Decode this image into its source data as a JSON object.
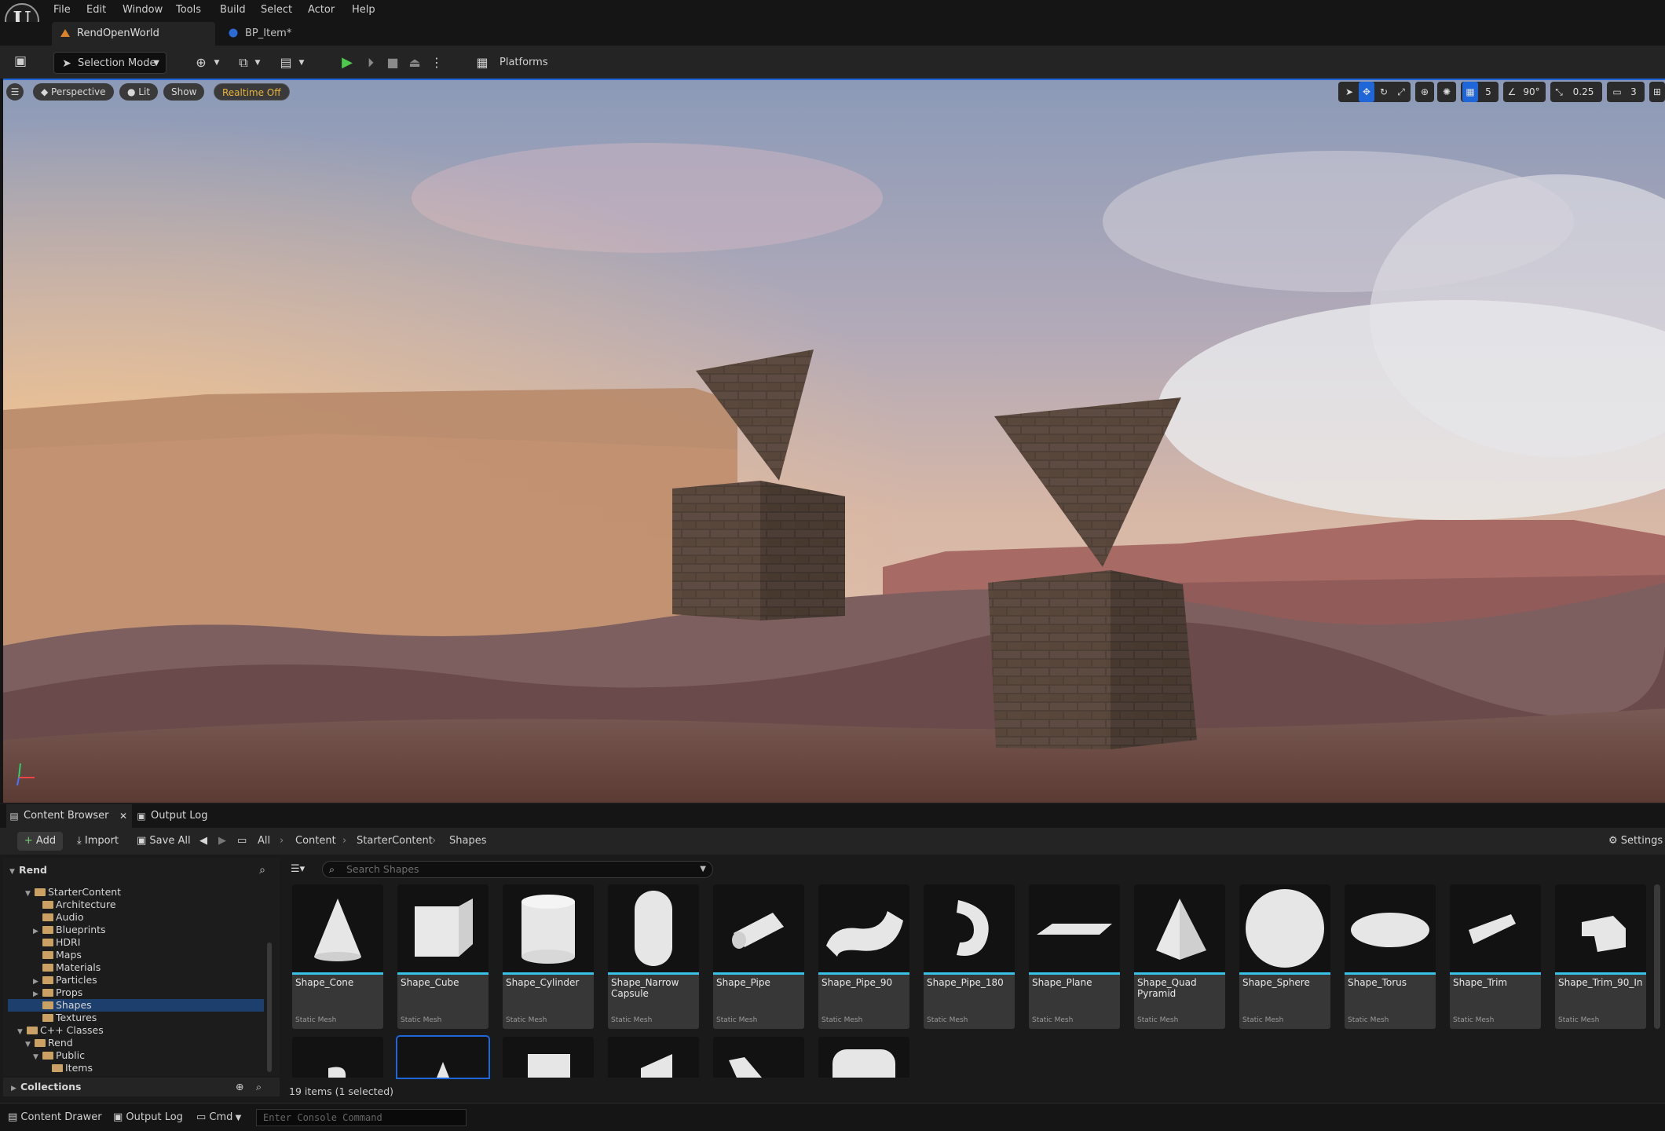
{
  "menu": [
    "File",
    "Edit",
    "Window",
    "Tools",
    "Build",
    "Select",
    "Actor",
    "Help"
  ],
  "tabs": {
    "level": "RendOpenWorld",
    "blueprint": "BP_Item*"
  },
  "toolbar": {
    "mode": "Selection Mode",
    "platforms": "Platforms"
  },
  "viewport": {
    "perspective": "Perspective",
    "lit": "Lit",
    "show": "Show",
    "realtime": "Realtime Off",
    "grid_snap": "5",
    "rotation_snap": "90°",
    "scale_snap": "0.25",
    "camera_speed": "3"
  },
  "panels": {
    "content_browser": "Content Browser",
    "output_log": "Output Log"
  },
  "cb_toolbar": {
    "add": "Add",
    "import": "Import",
    "save_all": "Save All",
    "settings": "Settings"
  },
  "breadcrumb": [
    "All",
    "Content",
    "StarterContent",
    "Shapes"
  ],
  "tree": {
    "root": "Rend",
    "items": [
      "StarterContent",
      "Architecture",
      "Audio",
      "Blueprints",
      "HDRI",
      "Maps",
      "Materials",
      "Particles",
      "Props",
      "Shapes",
      "Textures",
      "C++ Classes",
      "Rend",
      "Public",
      "Items"
    ],
    "collections": "Collections"
  },
  "search": {
    "placeholder": "Search Shapes"
  },
  "assets": [
    {
      "name": "Shape_Cone",
      "type": "Static Mesh"
    },
    {
      "name": "Shape_Cube",
      "type": "Static Mesh"
    },
    {
      "name": "Shape_Cylinder",
      "type": "Static Mesh"
    },
    {
      "name": "Shape_Narrow Capsule",
      "type": "Static Mesh"
    },
    {
      "name": "Shape_Pipe",
      "type": "Static Mesh"
    },
    {
      "name": "Shape_Pipe_90",
      "type": "Static Mesh"
    },
    {
      "name": "Shape_Pipe_180",
      "type": "Static Mesh"
    },
    {
      "name": "Shape_Plane",
      "type": "Static Mesh"
    },
    {
      "name": "Shape_Quad Pyramid",
      "type": "Static Mesh"
    },
    {
      "name": "Shape_Sphere",
      "type": "Static Mesh"
    },
    {
      "name": "Shape_Torus",
      "type": "Static Mesh"
    },
    {
      "name": "Shape_Trim",
      "type": "Static Mesh"
    },
    {
      "name": "Shape_Trim_90_In",
      "type": "Static Mesh"
    }
  ],
  "status": "19 items (1 selected)",
  "statusbar": {
    "drawer": "Content Drawer",
    "output_log": "Output Log",
    "cmd": "Cmd",
    "console_placeholder": "Enter Console Command"
  },
  "colors": {
    "accent": "#1f66d8",
    "thumb_bar": "#39c2e8",
    "realtime": "#e7b43a",
    "play": "#4ec94e"
  }
}
